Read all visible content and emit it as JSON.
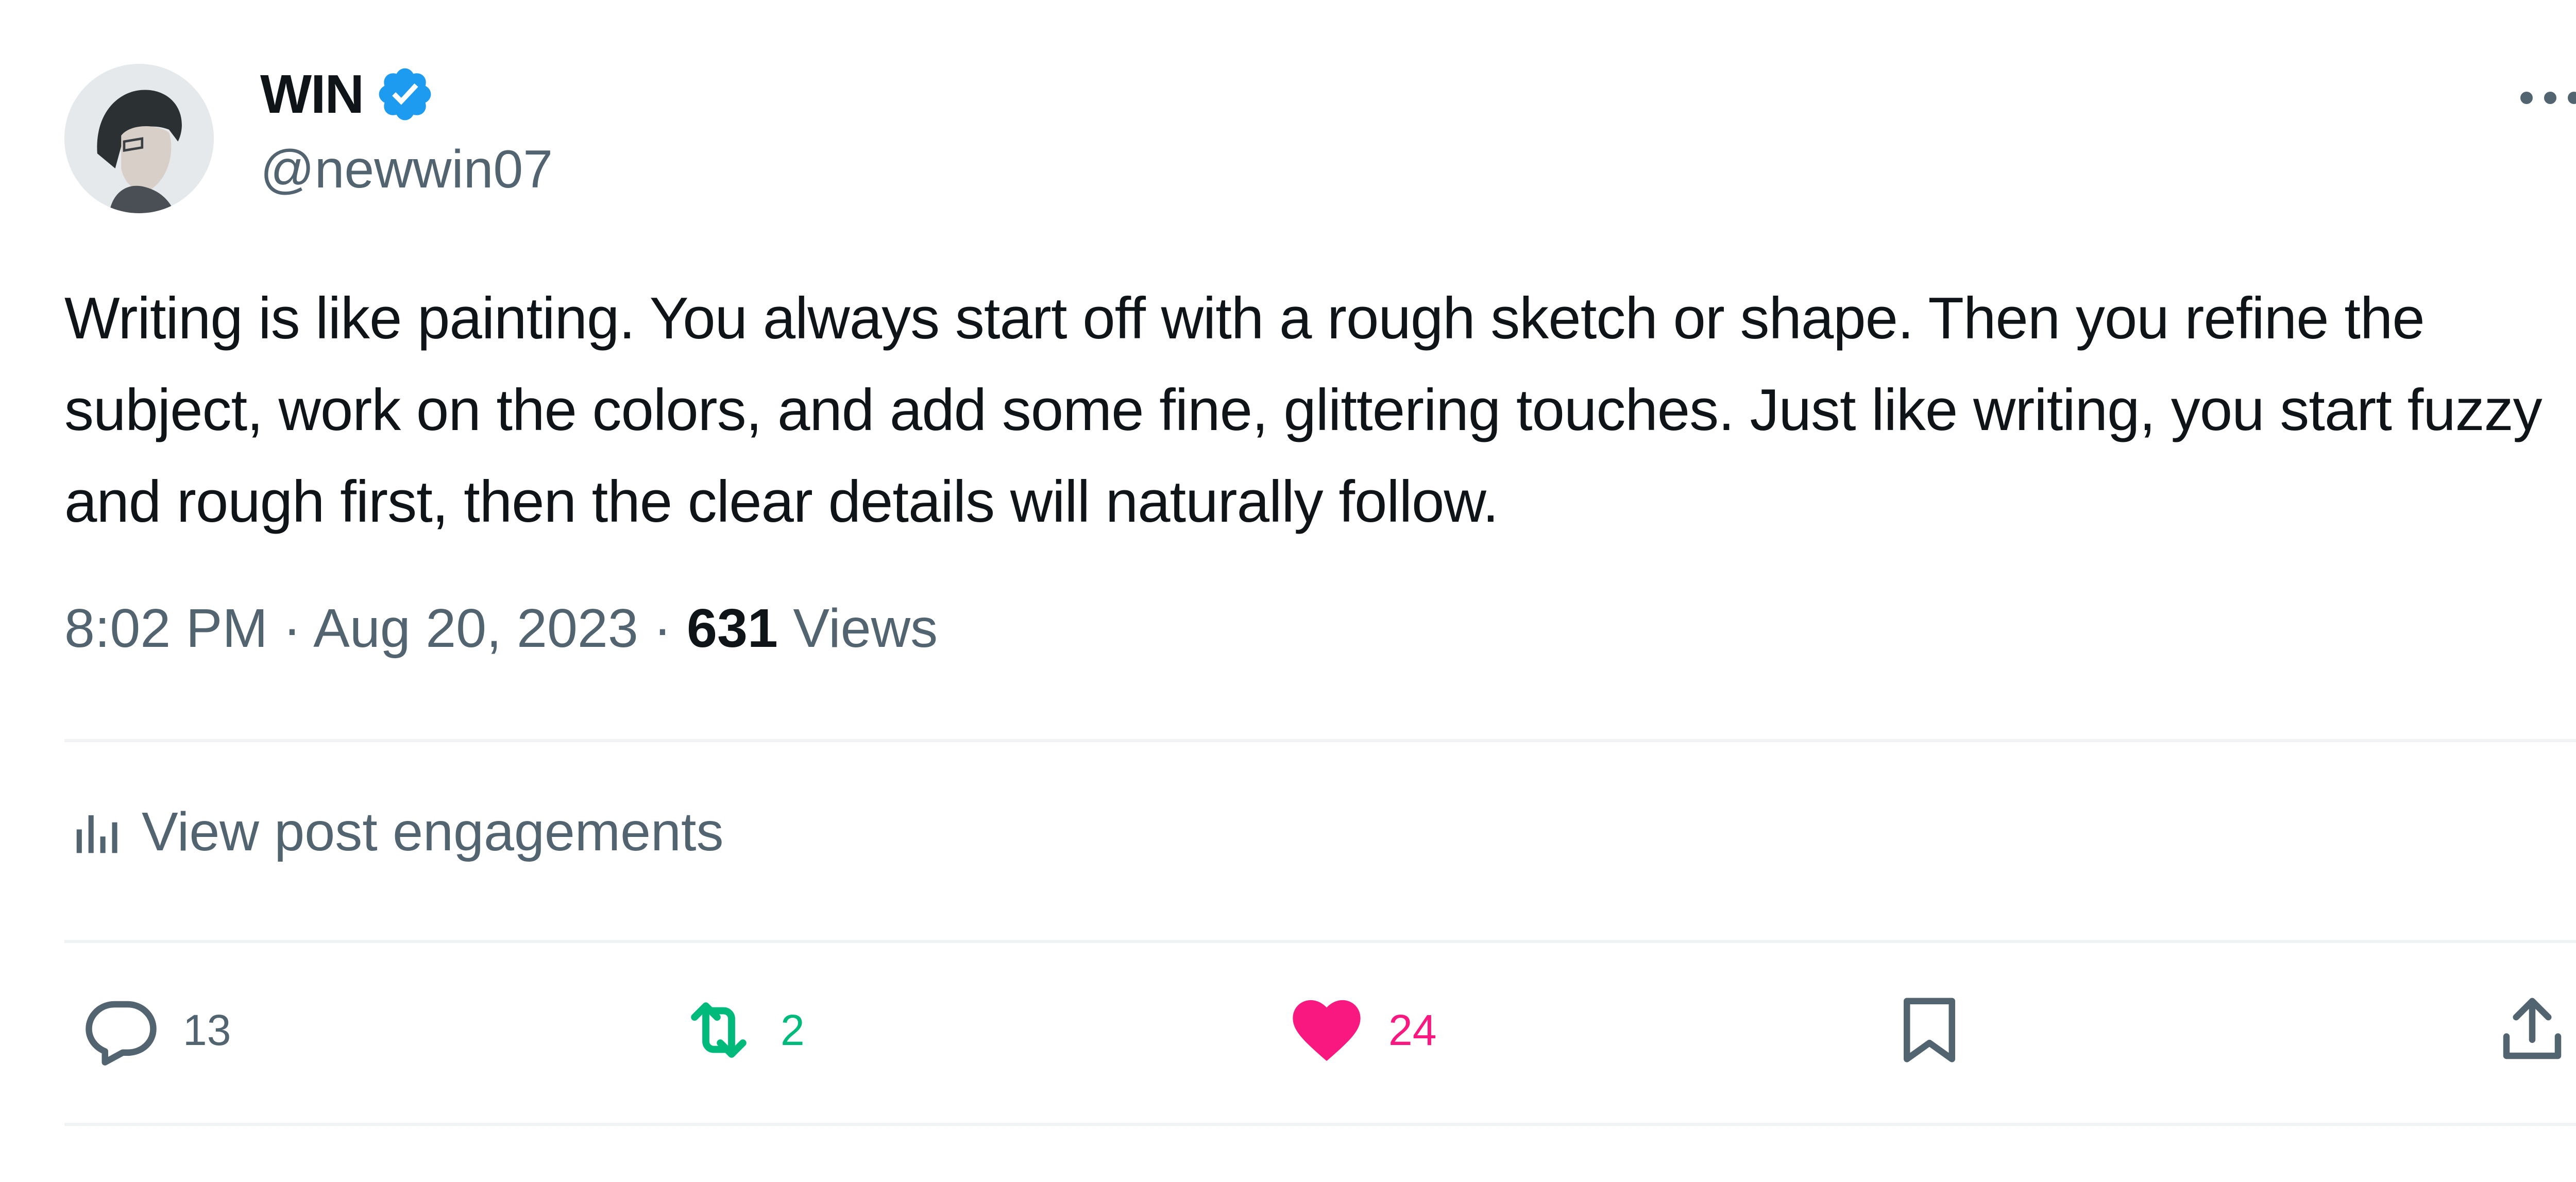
{
  "author": {
    "display_name": "WIN",
    "handle": "@newwin07",
    "verified": true
  },
  "tweet": {
    "text": "Writing is like painting. You always start off with a rough sketch or shape. Then you refine the subject, work on the colors, and add some fine, glittering touches. Just like writing, you start fuzzy and rough first, then the clear details will naturally follow.",
    "time": "8:02 PM",
    "separator": "·",
    "date": "Aug 20, 2023",
    "views_count": "631",
    "views_label": "Views"
  },
  "engagements_link": "View post engagements",
  "actions": {
    "reply_count": "13",
    "retweet_count": "2",
    "like_count": "24"
  },
  "colors": {
    "text_primary": "#0f1419",
    "text_secondary": "#536471",
    "verified": "#1d9bf0",
    "retweet": "#00ba7c",
    "like": "#f91880",
    "divider": "#eff3f4"
  },
  "icons": {
    "more": "more-icon",
    "verified": "verified-badge-icon",
    "engagements": "bar-chart-icon",
    "reply": "reply-icon",
    "retweet": "retweet-icon",
    "like": "heart-icon",
    "bookmark": "bookmark-icon",
    "share": "share-icon"
  }
}
